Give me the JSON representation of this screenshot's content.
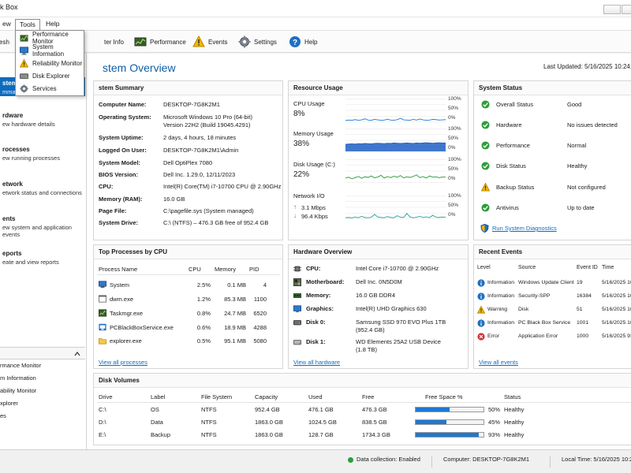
{
  "window": {
    "title": "k Box"
  },
  "menubar": {
    "items": [
      "ew",
      "Tools",
      "Help"
    ]
  },
  "tools_menu": {
    "items": [
      "Performance Monitor",
      "System Information",
      "Reliability Monitor",
      "Disk Explorer",
      "Services"
    ]
  },
  "toolbar": {
    "refresh_label": "esh",
    "items": [
      "ter Info",
      "Performance",
      "Events",
      "Settings",
      "Help"
    ]
  },
  "sidebar": {
    "nav": [
      {
        "title": "stem",
        "desc": "mmar"
      },
      {
        "title": "rdware",
        "desc": "ew hardware details"
      },
      {
        "title": "rocesses",
        "desc": "ew running processes"
      },
      {
        "title": "etwork",
        "desc": "etwork status and connections"
      },
      {
        "title": "ents",
        "desc": "ew system and application events"
      },
      {
        "title": "eports",
        "desc": "eate and view reports"
      }
    ],
    "tools": [
      "rmance Monitor",
      "m Information",
      "ability Monitor",
      "xplorer",
      "es"
    ]
  },
  "main": {
    "title": "stem Overview",
    "last_updated": "Last Updated: 5/16/2025 10:24:3"
  },
  "system_summary": {
    "title": "stem Summary",
    "rows": [
      {
        "label": "Computer Name:",
        "value": "DESKTOP-7G8K2M1"
      },
      {
        "label": "Operating System:",
        "value": "Microsoft Windows 10 Pro (64-bit)",
        "value2": "Version 22H2 (Build 19045.4291)"
      },
      {
        "label": "System Uptime:",
        "value": "2 days, 4 hours, 18 minutes"
      },
      {
        "label": "Logged On User:",
        "value": "DESKTOP-7G8K2M1\\Admin"
      },
      {
        "label": "System Model:",
        "value": "Dell OptiPlex 7080"
      },
      {
        "label": "BIOS Version:",
        "value": "Dell Inc. 1.29.0, 12/11/2023"
      },
      {
        "label": "CPU:",
        "value": "Intel(R) Core(TM) i7-10700 CPU @ 2.90GHz"
      },
      {
        "label": "Memory (RAM):",
        "value": "16.0 GB"
      },
      {
        "label": "Page File:",
        "value": "C:\\pagefile.sys (System managed)"
      },
      {
        "label": "System Drive:",
        "value": "C:\\ (NTFS) – 476.3 GB free of 952.4 GB"
      }
    ]
  },
  "resource_usage": {
    "title": "Resource Usage",
    "axis": [
      "100%",
      "50%",
      "0%"
    ],
    "cpu": {
      "label": "CPU Usage",
      "value": "8%"
    },
    "memory": {
      "label": "Memory Usage",
      "value": "38%"
    },
    "disk": {
      "label": "Disk Usage (C:)",
      "value": "22%"
    },
    "network": {
      "label": "Network I/O",
      "up": "3.1 Mbps",
      "down": "96.4 Kbps"
    }
  },
  "chart_data": [
    {
      "type": "line",
      "series": [
        {
          "values": [
            4,
            6,
            5,
            8,
            5,
            7,
            12,
            6,
            5,
            9,
            7,
            5,
            6,
            10,
            6,
            5,
            8,
            14,
            7,
            6,
            5,
            9,
            6,
            11,
            7,
            5,
            6,
            9,
            8,
            6,
            7,
            8
          ]
        }
      ],
      "ylim": [
        0,
        100
      ],
      "color": "#1f78d1"
    },
    {
      "type": "area",
      "series": [
        {
          "values": [
            32,
            33,
            34,
            33,
            35,
            34,
            36,
            35,
            34,
            36,
            37,
            36,
            35,
            37,
            36,
            38,
            37,
            36,
            37,
            38,
            37,
            36,
            38,
            37,
            38,
            39,
            38,
            37,
            38,
            39,
            38,
            38
          ]
        }
      ],
      "ylim": [
        0,
        100
      ],
      "color": "#1f5fc4"
    },
    {
      "type": "line",
      "series": [
        {
          "values": [
            18,
            22,
            15,
            20,
            26,
            17,
            24,
            21,
            28,
            19,
            23,
            31,
            18,
            25,
            20,
            27,
            22,
            30,
            19,
            24,
            21,
            26,
            33,
            20,
            25,
            18,
            28,
            22,
            24,
            20,
            23,
            22
          ]
        }
      ],
      "ylim": [
        0,
        100
      ],
      "color": "#2a9d3c"
    },
    {
      "type": "line",
      "series": [
        {
          "values": [
            3,
            4,
            2,
            6,
            3,
            9,
            4,
            3,
            5,
            18,
            6,
            4,
            3,
            8,
            4,
            3,
            12,
            5,
            4,
            22,
            6,
            3,
            5,
            9,
            4,
            7,
            3,
            14,
            5,
            4,
            6,
            5
          ]
        }
      ],
      "ylim": [
        0,
        100
      ],
      "color": "#2a9d8f"
    }
  ],
  "system_status": {
    "title": "System Status",
    "rows": [
      {
        "label": "Overall Status",
        "value": "Good",
        "icon": "check-icon"
      },
      {
        "label": "Hardware",
        "value": "No issues detected",
        "icon": "check-icon"
      },
      {
        "label": "Performance",
        "value": "Normal",
        "icon": "check-icon"
      },
      {
        "label": "Disk Status",
        "value": "Healthy",
        "icon": "check-icon"
      },
      {
        "label": "Backup Status",
        "value": "Not configured",
        "icon": "warning-icon"
      },
      {
        "label": "Antivirus",
        "value": "Up to date",
        "icon": "check-icon"
      }
    ],
    "diagnostics_link": "Run System Diagnostics"
  },
  "processes": {
    "title": "Top Processes by CPU",
    "headers": [
      "Process Name",
      "CPU",
      "Memory",
      "PID"
    ],
    "rows": [
      [
        "System",
        "2.5%",
        "0.1 MB",
        "4"
      ],
      [
        "dwm.exe",
        "1.2%",
        "85.3 MB",
        "1100"
      ],
      [
        "Taskmgr.exe",
        "0.8%",
        "24.7 MB",
        "6520"
      ],
      [
        "PCBlackBoxService.exe",
        "0.6%",
        "18.9 MB",
        "4288"
      ],
      [
        "explorer.exe",
        "0.5%",
        "95.1 MB",
        "5080"
      ]
    ],
    "link": "View all processes"
  },
  "hardware": {
    "title": "Hardware Overview",
    "rows": [
      {
        "label": "CPU:",
        "value": "Intel Core i7-10700 @ 2.90GHz"
      },
      {
        "label": "Motherboard:",
        "value": "Dell Inc. 0N5D0M"
      },
      {
        "label": "Memory:",
        "value": "16.0 GB DDR4"
      },
      {
        "label": "Graphics:",
        "value": "Intel(R) UHD Graphics 630"
      },
      {
        "label": "Disk 0:",
        "value": "Samsung SSD 970 EVO Plus 1TB",
        "value2": "(952.4 GB)"
      },
      {
        "label": "Disk 1:",
        "value": "WD Elements 25A2 USB Device",
        "value2": "(1.8 TB)"
      }
    ],
    "link": "View all hardware"
  },
  "events": {
    "title": "Recent Events",
    "headers": [
      "Level",
      "Source",
      "Event ID",
      "Time"
    ],
    "rows": [
      {
        "level": "Information",
        "source": "Windows Update Client",
        "id": "19",
        "time": "5/16/2025 10",
        "icon": "info-icon"
      },
      {
        "level": "Information",
        "source": "Security-SPP",
        "id": "16384",
        "time": "5/16/2025 10",
        "icon": "info-icon"
      },
      {
        "level": "Warning",
        "source": "Disk",
        "id": "51",
        "time": "5/16/2025 10",
        "icon": "warning-icon"
      },
      {
        "level": "Information",
        "source": "PC Black Box Service",
        "id": "1001",
        "time": "5/16/2025 10",
        "icon": "info-icon"
      },
      {
        "level": "Error",
        "source": "Application Error",
        "id": "1000",
        "time": "5/16/2025 9:5",
        "icon": "error-icon"
      }
    ],
    "link": "View all events"
  },
  "volumes": {
    "title": "Disk Volumes",
    "headers": [
      "Drive",
      "Label",
      "File System",
      "Capacity",
      "Used",
      "Free",
      "Free Space %",
      "Status"
    ],
    "rows": [
      {
        "drive": "C:\\",
        "label": "OS",
        "fs": "NTFS",
        "capacity": "952.4 GB",
        "used": "476.1 GB",
        "free": "476.3 GB",
        "pct_label": "50%",
        "pct": 0.5,
        "status": "Healthy"
      },
      {
        "drive": "D:\\",
        "label": "Data",
        "fs": "NTFS",
        "capacity": "1863.0 GB",
        "used": "1024.5 GB",
        "free": "838.5 GB",
        "pct_label": "45%",
        "pct": 0.45,
        "status": "Healthy"
      },
      {
        "drive": "E:\\",
        "label": "Backup",
        "fs": "NTFS",
        "capacity": "1863.0 GB",
        "used": "128.7 GB",
        "free": "1734.3 GB",
        "pct_label": "93%",
        "pct": 0.93,
        "status": "Healthy"
      }
    ]
  },
  "statusbar": {
    "collection": "Data collection: Enabled",
    "computer": "Computer: DESKTOP-7G8K2M1",
    "time": "Local Time: 5/16/2025 10:24:3"
  },
  "colors": {
    "accent": "#0f6cbd",
    "title_blue": "#0f5fa8",
    "ok_green": "#2e9d3a",
    "warn_yellow": "#f2b600",
    "error_red": "#d13438",
    "info_blue": "#1f6fc5"
  }
}
